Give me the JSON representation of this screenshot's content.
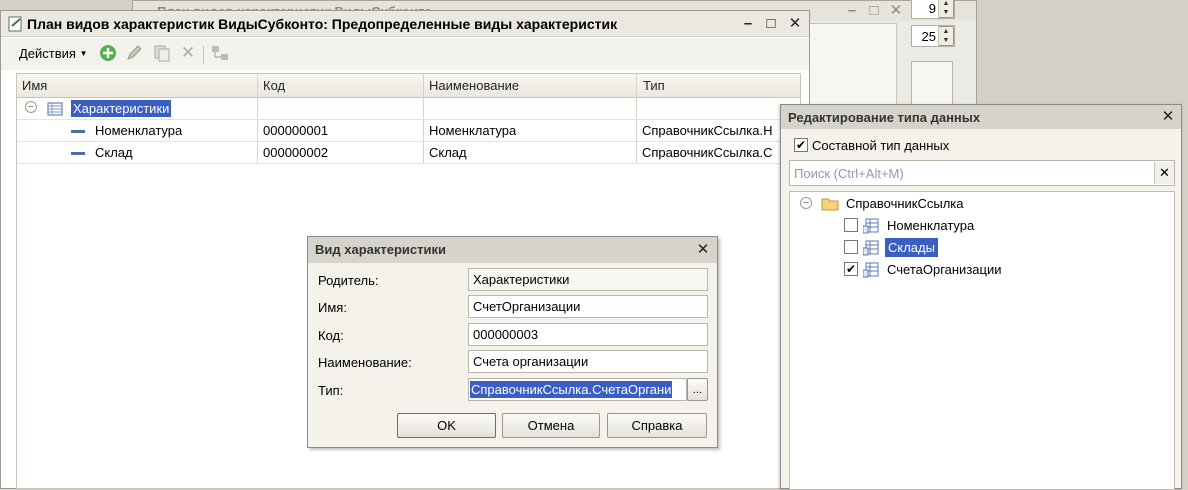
{
  "bg_window": {
    "title": "План видов характеристик ВидыСубконто",
    "spin1": "9",
    "spin2": "25",
    "minimize": "–",
    "maximize": "□",
    "close": "✕"
  },
  "main_window": {
    "title": "План видов характеристик ВидыСубконто: Предопределенные виды характеристик",
    "minimize": "–",
    "maximize": "□",
    "close": "✕",
    "toolbar": {
      "actions_label": "Действия",
      "icons": [
        "add-icon",
        "edit-icon",
        "copy-icon",
        "delete-icon",
        "hierarchy-icon"
      ]
    },
    "table": {
      "columns": [
        "Имя",
        "Код",
        "Наименование",
        "Тип"
      ],
      "rows": [
        {
          "name": "Характеристики",
          "code": "",
          "title": "",
          "type": ""
        },
        {
          "name": "Номенклатура",
          "code": "000000001",
          "title": "Номенклатура",
          "type": "СправочникСсылка.Н"
        },
        {
          "name": "Склад",
          "code": "000000002",
          "title": "Склад",
          "type": "СправочникСсылка.С"
        }
      ]
    }
  },
  "dialog": {
    "title": "Вид характеристики",
    "close": "✕",
    "fields": [
      {
        "label": "Родитель:",
        "value": "Характеристики"
      },
      {
        "label": "Имя:",
        "value": "СчетОрганизации"
      },
      {
        "label": "Код:",
        "value": "000000003"
      },
      {
        "label": "Наименование:",
        "value": "Счета организации"
      },
      {
        "label": "Тип:",
        "value": "СправочникСсылка.СчетаОргани"
      }
    ],
    "ellipsis": "...",
    "buttons": {
      "ok": "OK",
      "cancel": "Отмена",
      "help": "Справка"
    }
  },
  "type_dialog": {
    "title": "Редактирование типа данных",
    "close": "✕",
    "composite_label": "Составной тип данных",
    "composite_checked": true,
    "search_placeholder": "Поиск (Ctrl+Alt+M)",
    "search_clear": "✕",
    "tree": {
      "root": "СправочникСсылка",
      "items": [
        {
          "label": "Номенклатура",
          "checked": false
        },
        {
          "label": "Склады",
          "checked": false,
          "selected": true
        },
        {
          "label": "СчетаОрганизации",
          "checked": true
        }
      ]
    }
  },
  "colors": {
    "selection": "#3a5ec2",
    "accent_green": "#4caf50"
  }
}
